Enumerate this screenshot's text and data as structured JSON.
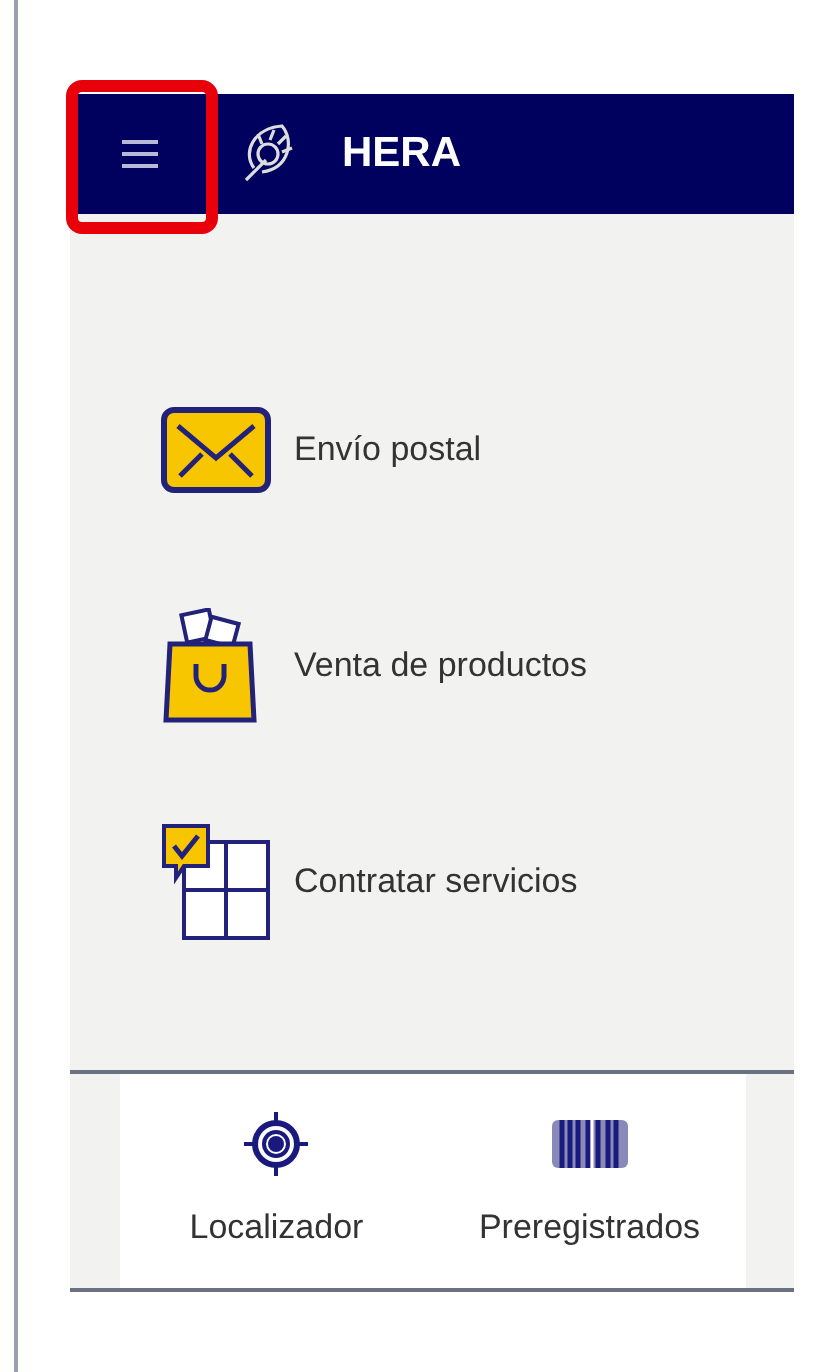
{
  "app_bar": {
    "title": "HERA",
    "menu_highlighted": true
  },
  "menu_items": [
    {
      "label": "Envío postal",
      "kind": "envelope"
    },
    {
      "label": "Venta de productos",
      "kind": "bag"
    },
    {
      "label": "Contratar servicios",
      "kind": "puzzle"
    }
  ],
  "bottom_nav": [
    {
      "label": "Localizador",
      "kind": "target"
    },
    {
      "label": "Preregistrados",
      "kind": "barcode"
    }
  ]
}
